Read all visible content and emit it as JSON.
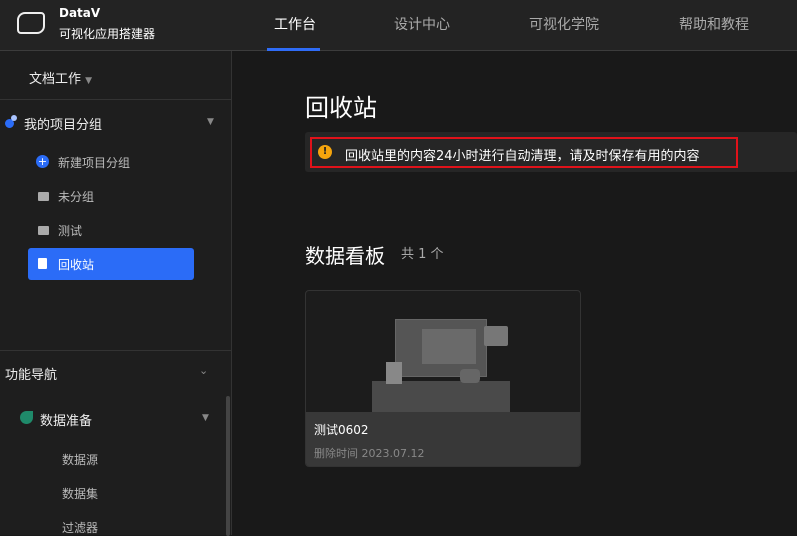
{
  "brand": {
    "name": "DataV",
    "subtitle": "可视化应用搭建器"
  },
  "nav": [
    "工作台",
    "设计中心",
    "可视化学院",
    "帮助和教程"
  ],
  "sidebar": {
    "workspace": "文档工作",
    "group_title": "我的项目分组",
    "items": [
      "新建项目分组",
      "未分组",
      "测试",
      "回收站"
    ],
    "func_nav": "功能导航",
    "data_prep": "数据准备",
    "data_items": [
      "数据源",
      "数据集",
      "过滤器"
    ]
  },
  "main": {
    "title": "回收站",
    "alert": "回收站里的内容24小时进行自动清理，请及时保存有用的内容",
    "section": "数据看板",
    "count": "共 1 个",
    "cards": [
      {
        "name": "测试0602",
        "deleted": "删除时间 2023.07.12"
      }
    ]
  },
  "colors": {
    "accent": "#2b6cf7",
    "warning": "#f5a40d",
    "highlight": "#e0121a"
  }
}
